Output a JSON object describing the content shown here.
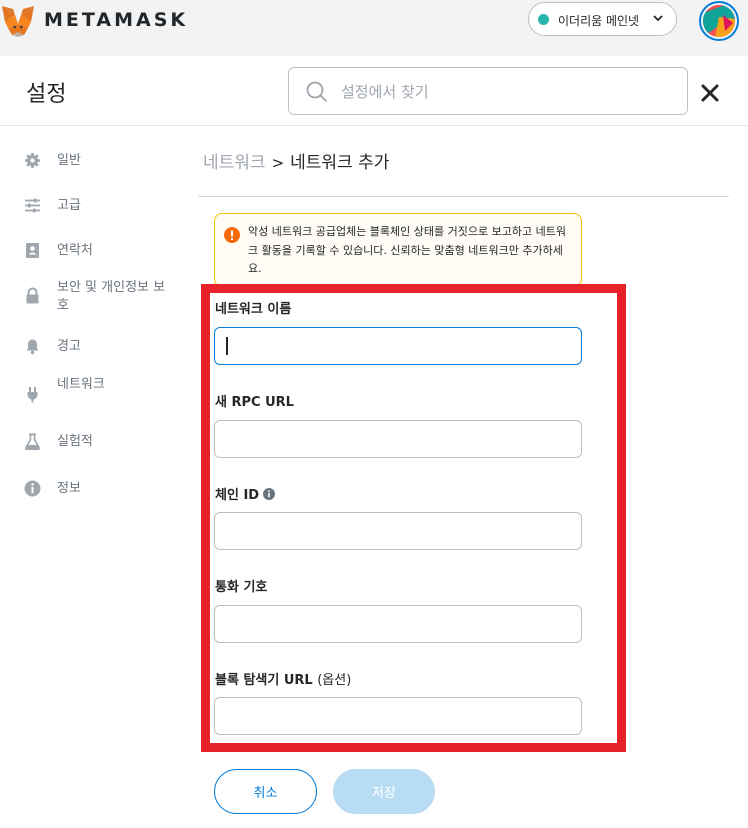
{
  "app": {
    "brand": "METAMASK",
    "network": "이더리움 메인넷",
    "colors": {
      "accent": "#037dd6",
      "network_dot": "#29b6af",
      "warning_border": "#f8c000",
      "highlight_frame": "#e8222a"
    }
  },
  "settings": {
    "title": "설정",
    "search": {
      "placeholder": "설정에서 찾기",
      "value": ""
    }
  },
  "sidebar": {
    "items": [
      {
        "label": "일반",
        "icon": "gear-icon"
      },
      {
        "label": "고급",
        "icon": "sliders-icon"
      },
      {
        "label": "연락처",
        "icon": "contact-book-icon"
      },
      {
        "label": "보안 및 개인정보 보호",
        "icon": "lock-icon"
      },
      {
        "label": "경고",
        "icon": "bell-icon"
      },
      {
        "label": "네트워크",
        "icon": "plug-icon"
      },
      {
        "label": "실험적",
        "icon": "flask-icon"
      },
      {
        "label": "정보",
        "icon": "info-circle-icon"
      }
    ]
  },
  "breadcrumb": {
    "parent": "네트워크",
    "separator": ">",
    "current": "네트워크 추가"
  },
  "warning": {
    "text": "악성 네트워크 공급업체는 블록체인 상태를 거짓으로 보고하고 네트워크 활동을 기록할 수 있습니다. 신뢰하는 맞춤형 네트워크만 추가하세요."
  },
  "form": {
    "fields": [
      {
        "label": "네트워크 이름",
        "value": ""
      },
      {
        "label": "새 RPC URL",
        "value": ""
      },
      {
        "label": "체인 ID",
        "value": ""
      },
      {
        "label": "통화 기호",
        "value": ""
      },
      {
        "label": "블록 탐색기 URL",
        "optional": "(옵션)",
        "value": ""
      }
    ]
  },
  "buttons": {
    "cancel": "취소",
    "save": "저장"
  }
}
